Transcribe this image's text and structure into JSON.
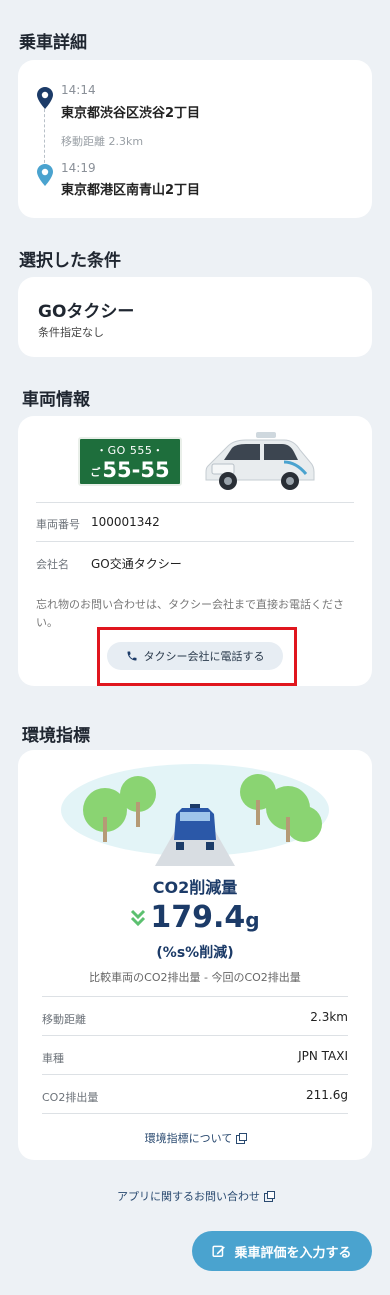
{
  "ride": {
    "section_title": "乗車詳細",
    "pickup_time": "14:14",
    "pickup_address": "東京都渋谷区渋谷2丁目",
    "distance_text": "移動距離 2.3km",
    "dropoff_time": "14:19",
    "dropoff_address": "東京都港区南青山2丁目"
  },
  "conditions": {
    "section_title": "選択した条件",
    "name": "GOタクシー",
    "sub": "条件指定なし"
  },
  "vehicle": {
    "section_title": "車両情報",
    "plate_top": "・GO 555・",
    "plate_kana": "ご",
    "plate_number": "55-55",
    "number_label": "車両番号",
    "number_value": "100001342",
    "company_label": "会社名",
    "company_value": "GO交通タクシー",
    "note": "忘れ物のお問い合わせは、タクシー会社まで直接お電話ください。",
    "call_button": "タクシー会社に電話する",
    "car_color": "#e8ecee",
    "plate_color": "#1e6e3c"
  },
  "environment": {
    "section_title": "環境指標",
    "co2_title": "CO2削減量",
    "co2_value": "179.4",
    "co2_unit": "g",
    "co2_percent": "(%s%削減)",
    "co2_formula": "比較車両のCO2排出量 - 今回のCO2排出量",
    "rows": [
      {
        "label": "移動距離",
        "value": "2.3km"
      },
      {
        "label": "車種",
        "value": "JPN TAXI"
      },
      {
        "label": "CO2排出量",
        "value": "211.6g"
      }
    ],
    "link": "環境指標について"
  },
  "footer": {
    "contact_link": "アプリに関するお問い合わせ",
    "rate_button": "乗車評価を入力する"
  },
  "colors": {
    "accent": "#4aa3cf",
    "navy": "#1c3b68",
    "highlight": "#e0161e"
  }
}
